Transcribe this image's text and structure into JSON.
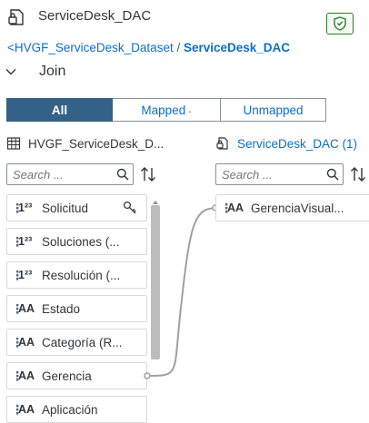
{
  "header": {
    "title": "ServiceDesk_DAC",
    "breadcrumb_parent": "<HVGF_ServiceDesk_Dataset",
    "breadcrumb_sep": " / ",
    "breadcrumb_current": "ServiceDesk_DAC"
  },
  "join": {
    "title": "Join"
  },
  "filter_tabs": [
    {
      "label": "All",
      "selected": true
    },
    {
      "label": "Mapped",
      "selected": false,
      "indicator": "."
    },
    {
      "label": "Unmapped",
      "selected": false
    }
  ],
  "left_panel": {
    "title": "HVGF_ServiceDesk_D...",
    "search_placeholder": "Search ...",
    "fields": [
      {
        "type": "1²³",
        "name": "Solicitud",
        "key": true
      },
      {
        "type": "1²³",
        "name": "Soluciones (..."
      },
      {
        "type": "1²³",
        "name": "Resolución (..."
      },
      {
        "type": "AA",
        "name": "Estado"
      },
      {
        "type": "AA",
        "name": "Categoría (R..."
      },
      {
        "type": "AA",
        "name": "Gerencia"
      },
      {
        "type": "AA",
        "name": "Aplicación"
      }
    ]
  },
  "right_panel": {
    "title": "ServiceDesk_DAC (1)",
    "search_placeholder": "Search ...",
    "fields": [
      {
        "type": "AA",
        "name": "GerenciaVisual..."
      }
    ]
  },
  "colors": {
    "accent": "#0a6ed1",
    "selected_tab": "#346187",
    "shield": "#2b7d2b",
    "link_line": "#a0a0a0"
  },
  "icons": [
    "dataset-lock-icon",
    "shield-check-icon",
    "chevron-down-icon",
    "table-icon",
    "search-icon",
    "sort-icon",
    "key-icon"
  ]
}
